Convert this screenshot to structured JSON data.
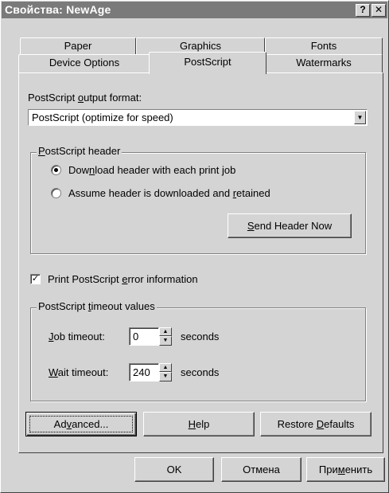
{
  "window": {
    "title": "Свойства: NewAge",
    "help_glyph": "?",
    "close_glyph": "✕"
  },
  "tabs": {
    "row_back": [
      "Paper",
      "Graphics",
      "Fonts"
    ],
    "row_front": [
      "Device Options",
      "PostScript",
      "Watermarks"
    ],
    "active": "PostScript"
  },
  "output_format": {
    "label_pre": "PostScript ",
    "label_u": "o",
    "label_post": "utput format:",
    "value": "PostScript (optimize for speed)"
  },
  "header_group": {
    "legend_u": "P",
    "legend_post": "ostScript header",
    "radio1_pre": "Dow",
    "radio1_u": "n",
    "radio1_post": "load header with each print job",
    "radio2_pre": "Assume header is downloaded and ",
    "radio2_u": "r",
    "radio2_post": "etained",
    "selected": "download",
    "send_u": "S",
    "send_post": "end Header Now"
  },
  "print_error": {
    "checked": true,
    "check_glyph": "✓",
    "label_pre": "Print PostScript ",
    "label_u": "e",
    "label_post": "rror information"
  },
  "timeout_group": {
    "legend_pre": "PostScript ",
    "legend_u": "t",
    "legend_post": "imeout values",
    "job_u": "J",
    "job_post": "ob timeout:",
    "job_value": "0",
    "wait_u": "W",
    "wait_post": "ait timeout:",
    "wait_value": "240",
    "unit": "seconds"
  },
  "panel_buttons": {
    "advanced_pre": "Ad",
    "advanced_u": "v",
    "advanced_post": "anced...",
    "help_u": "H",
    "help_post": "elp",
    "restore_pre": "Restore ",
    "restore_u": "D",
    "restore_post": "efaults"
  },
  "dialog_buttons": {
    "ok": "OK",
    "cancel": "Отмена",
    "apply_pre": "При",
    "apply_u": "м",
    "apply_post": "енить"
  },
  "colors": {
    "face": "#d4d4d4",
    "title_bg": "#7a7a7a",
    "shadow": "#808080"
  }
}
